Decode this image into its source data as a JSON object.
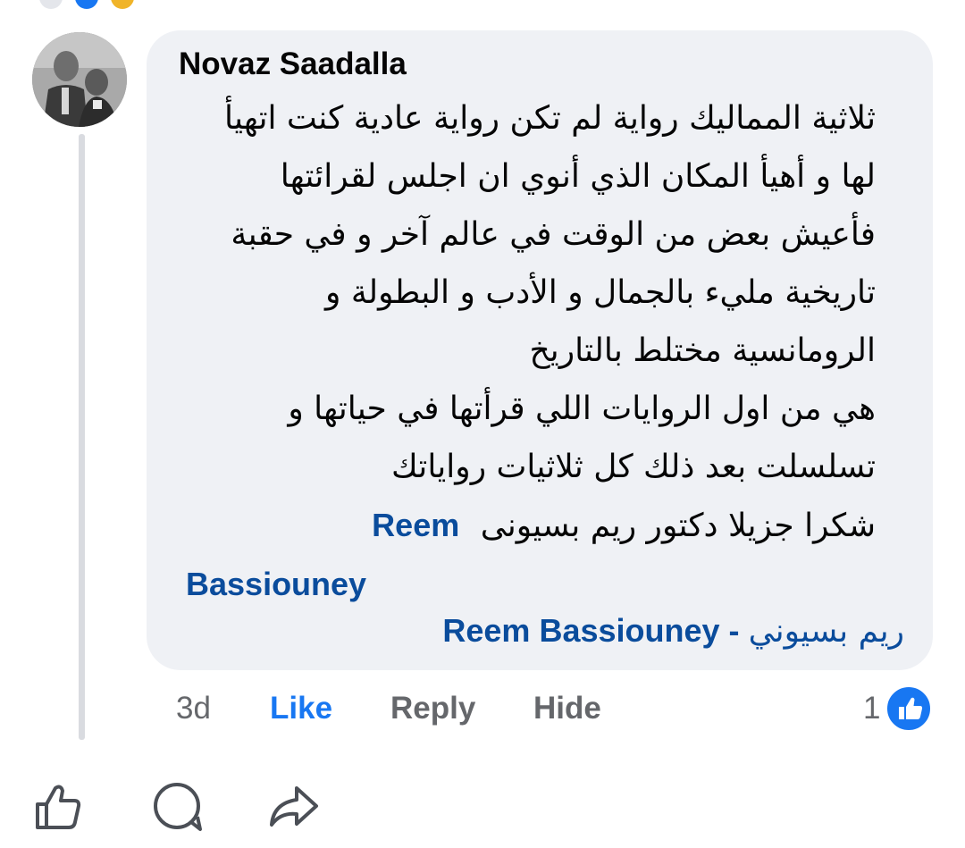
{
  "comment": {
    "author": "Novaz Saadalla",
    "text_lines": [
      "ثلاثية المماليك رواية لم تكن رواية عادية كنت اتهيأ",
      "لها و أهيأ المكان الذي أنوي ان اجلس لقرائتها",
      "فأعيش بعض من الوقت في عالم آخر و في حقبة",
      "تاريخية مليء بالجمال و الأدب و البطولة و",
      "الرومانسية مختلط بالتاريخ",
      "هي من اول الروايات اللي قرأتها في حياتها و",
      "تسلسلت بعد ذلك كل ثلاثيات رواياتك"
    ],
    "thanks_text": "شكرا جزيلا دكتور ريم بسيونى",
    "mention_1_first": "Reem",
    "mention_1_last": "Bassiouney",
    "mention_2_ar": "ريم بسيوني",
    "mention_2_separator": "-",
    "mention_2_en": "Reem Bassiouney"
  },
  "actions": {
    "time": "3d",
    "like": "Like",
    "reply": "Reply",
    "hide": "Hide",
    "reaction_count": "1",
    "reaction_icon": "like-reaction-icon"
  },
  "bottom_bar": {
    "icons": [
      "thumbs-up-icon",
      "comment-icon",
      "share-icon"
    ]
  },
  "colors": {
    "link": "#0a4c9c",
    "like_active": "#1877f2",
    "muted": "#65676b",
    "bubble": "#eff1f5"
  }
}
